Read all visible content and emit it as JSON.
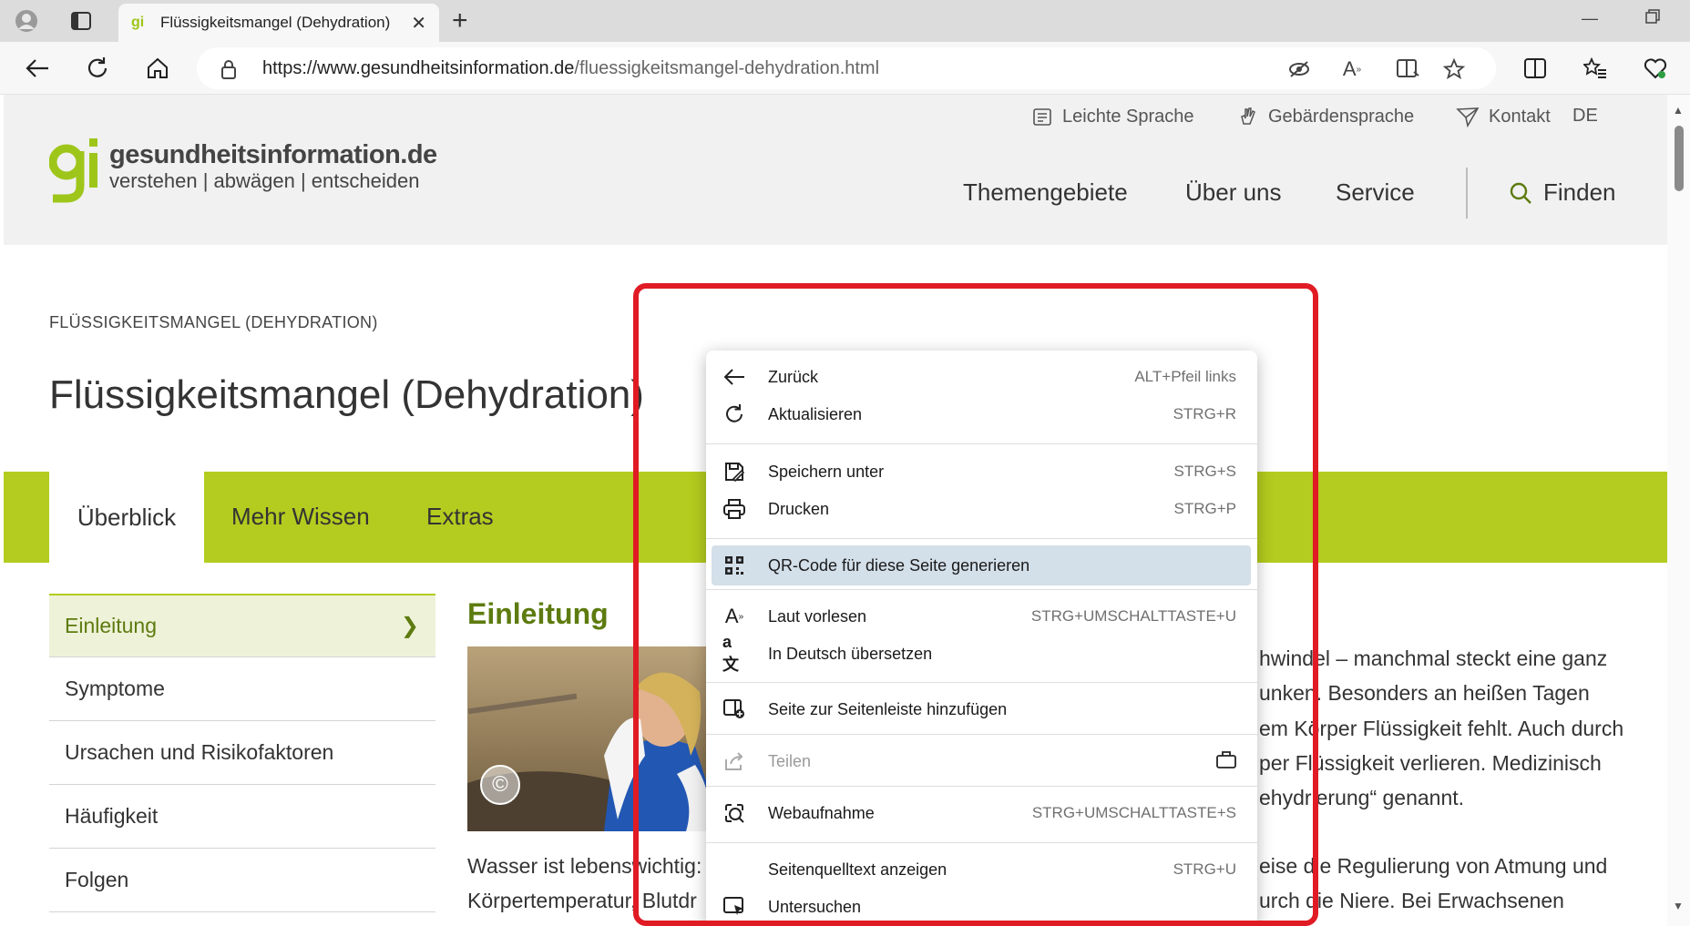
{
  "browser": {
    "tab_title": "Flüssigkeitsmangel (Dehydration)",
    "url_host": "https://www.gesundheitsinformation.de",
    "url_path": "/fluessigkeitsmangel-dehydration.html"
  },
  "site": {
    "logo_mark": "gi",
    "logo_title": "gesundheitsinformation.de",
    "logo_subtitle": "verstehen | abwägen | entscheiden",
    "utility": [
      "Leichte Sprache",
      "Gebärdensprache",
      "Kontakt",
      "DE"
    ],
    "mainnav": [
      "Themengebiete",
      "Über uns",
      "Service",
      "Finden"
    ]
  },
  "article": {
    "breadcrumb": "FLÜSSIGKEITSMANGEL (DEHYDRATION)",
    "title": "Flüssigkeitsmangel (Dehydration)",
    "tabs": [
      "Überblick",
      "Mehr Wissen",
      "Extras"
    ],
    "sidebar": [
      "Einleitung",
      "Symptome",
      "Ursachen und Risikofaktoren",
      "Häufigkeit",
      "Folgen"
    ],
    "section_heading": "Einleitung",
    "copyright_symbol": "©",
    "right_lines": [
      "hwindel – manchmal steckt eine ganz",
      "unken. Besonders an heißen Tagen",
      "em Körper Flüssigkeit fehlt. Auch durch",
      "per Flüssigkeit verlieren. Medizinisch",
      "ehydrierung“ genannt."
    ],
    "bottom_left_lines": [
      "Wasser ist lebenswichtig:",
      "Körpertemperatur, Blutdr"
    ],
    "bottom_right_lines": [
      "eise die Regulierung von Atmung und",
      "urch die Niere. Bei Erwachsenen"
    ]
  },
  "context_menu": {
    "items": [
      {
        "label": "Zurück",
        "shortcut": "ALT+Pfeil links",
        "icon": "back-arrow-icon"
      },
      {
        "label": "Aktualisieren",
        "shortcut": "STRG+R",
        "icon": "refresh-icon"
      },
      {
        "label": "Speichern unter",
        "shortcut": "STRG+S",
        "icon": "save-icon"
      },
      {
        "label": "Drucken",
        "shortcut": "STRG+P",
        "icon": "printer-icon"
      },
      {
        "label": "QR-Code für diese Seite generieren",
        "shortcut": "",
        "icon": "qr-code-icon"
      },
      {
        "label": "Laut vorlesen",
        "shortcut": "STRG+UMSCHALTTASTE+U",
        "icon": "read-aloud-icon"
      },
      {
        "label": "In Deutsch übersetzen",
        "shortcut": "",
        "icon": "translate-icon"
      },
      {
        "label": "Seite zur Seitenleiste hinzufügen",
        "shortcut": "",
        "icon": "sidebar-add-icon"
      },
      {
        "label": "Teilen",
        "shortcut": "",
        "icon": "share-icon"
      },
      {
        "label": "Webaufnahme",
        "shortcut": "STRG+UMSCHALTTASTE+S",
        "icon": "web-capture-icon"
      },
      {
        "label": "Seitenquelltext anzeigen",
        "shortcut": "STRG+U",
        "icon": ""
      },
      {
        "label": "Untersuchen",
        "shortcut": "",
        "icon": "inspect-icon"
      }
    ]
  },
  "colors": {
    "brand_green": "#b3cc1f",
    "dark_green": "#5d7b0f",
    "highlight_annotation": "#e01b24",
    "menu_highlight": "#d3dfe9"
  }
}
